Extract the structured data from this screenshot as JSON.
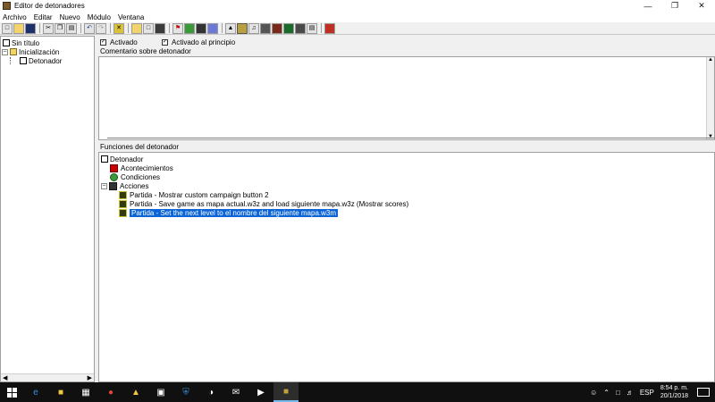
{
  "window": {
    "title": "Editor de detonadores"
  },
  "menu": [
    "Archivo",
    "Editar",
    "Nuevo",
    "Módulo",
    "Ventana"
  ],
  "toolbar": {
    "buttons": [
      "new-icon",
      "open-icon",
      "save-icon",
      "cut-icon",
      "copy-icon",
      "paste-icon",
      "undo-icon",
      "redo-icon",
      "delete-icon",
      "new-category-icon",
      "new-trigger-icon",
      "new-comment-icon",
      "red-flag-icon",
      "green-event-icon",
      "action-icon",
      "grid-icon",
      "terrain-icon",
      "unit-icon",
      "sound-icon",
      "object-icon",
      "camera-icon",
      "region-icon",
      "import-icon",
      "test-map-icon"
    ]
  },
  "tree": {
    "root": "Sin título",
    "category": "Inicialización",
    "trigger": "Detonador"
  },
  "trigger": {
    "enabled_label": "Activado",
    "initially_on_label": "Activado al principio",
    "comment_label": "Comentario sobre detonador",
    "functions_label": "Funciones del detonador"
  },
  "functions": {
    "root": "Detonador",
    "events": "Acontecimientos",
    "conditions": "Condiciones",
    "actions": "Acciones",
    "action_items": [
      "Partida - Mostrar custom campaign button 2",
      "Partida - Save game as mapa actual.w3z and load siguiente mapa.w3z (Mostrar scores)",
      "Partida - Set the next level to el nombre del siguiente mapa.w3m"
    ]
  },
  "taskbar": {
    "tray_language": "ESP",
    "time": "8:54 p. m.",
    "date": "20/1/2018"
  },
  "colors": {
    "selection": "#0a64d8",
    "taskbar": "#101010"
  }
}
